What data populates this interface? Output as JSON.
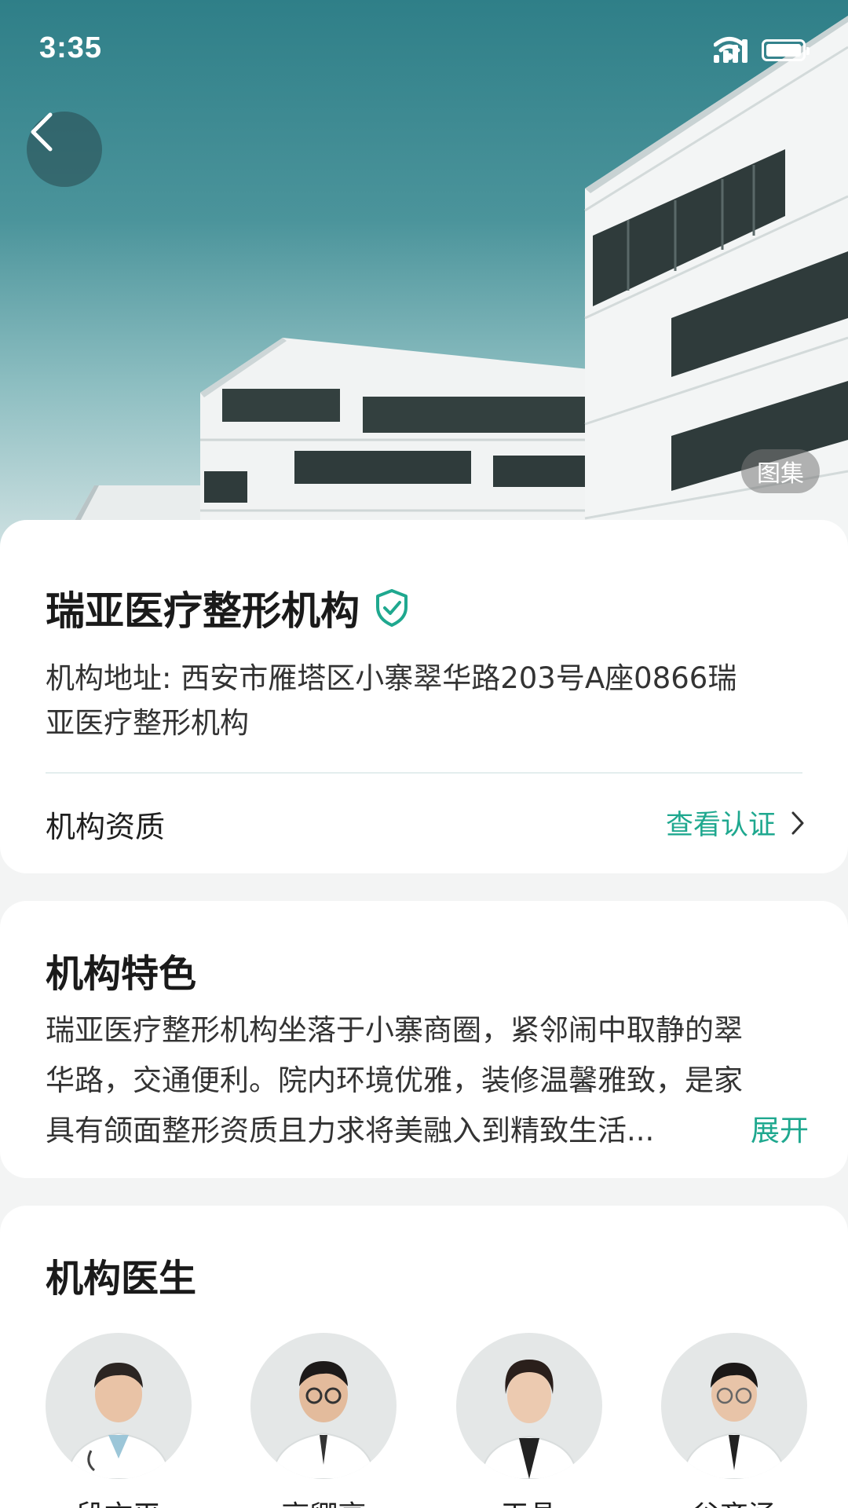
{
  "status_bar": {
    "time": "3:35"
  },
  "hero": {
    "gallery_label": "图集"
  },
  "institution": {
    "name": "瑞亚医疗整形机构",
    "address_line1": "机构地址: 西安市雁塔区小寨翠华路203号A座0866瑞",
    "address_line2": "亚医疗整形机构",
    "qualification_label": "机构资质",
    "qualification_link": "查看认证"
  },
  "features": {
    "title": "机构特色",
    "line1": "瑞亚医疗整形机构坐落于小寨商圈，紧邻闹中取静的翠",
    "line2": "华路，交通便利。院内环境优雅，装修温馨雅致，是家",
    "line3": "具有颌面整形资质且力求将美融入到精致生活...",
    "expand_label": "展开"
  },
  "doctors": {
    "title": "机构医生",
    "items": [
      {
        "name": "段文平"
      },
      {
        "name": "高卿亮"
      },
      {
        "name": "王晶"
      },
      {
        "name": "谷齐涵"
      }
    ]
  },
  "colors": {
    "accent": "#1fa88f",
    "hero_sky": "#2f7f88"
  },
  "icons": {
    "verified": "shield-check-icon",
    "back": "chevron-left-icon",
    "link": "chevron-right-icon"
  }
}
